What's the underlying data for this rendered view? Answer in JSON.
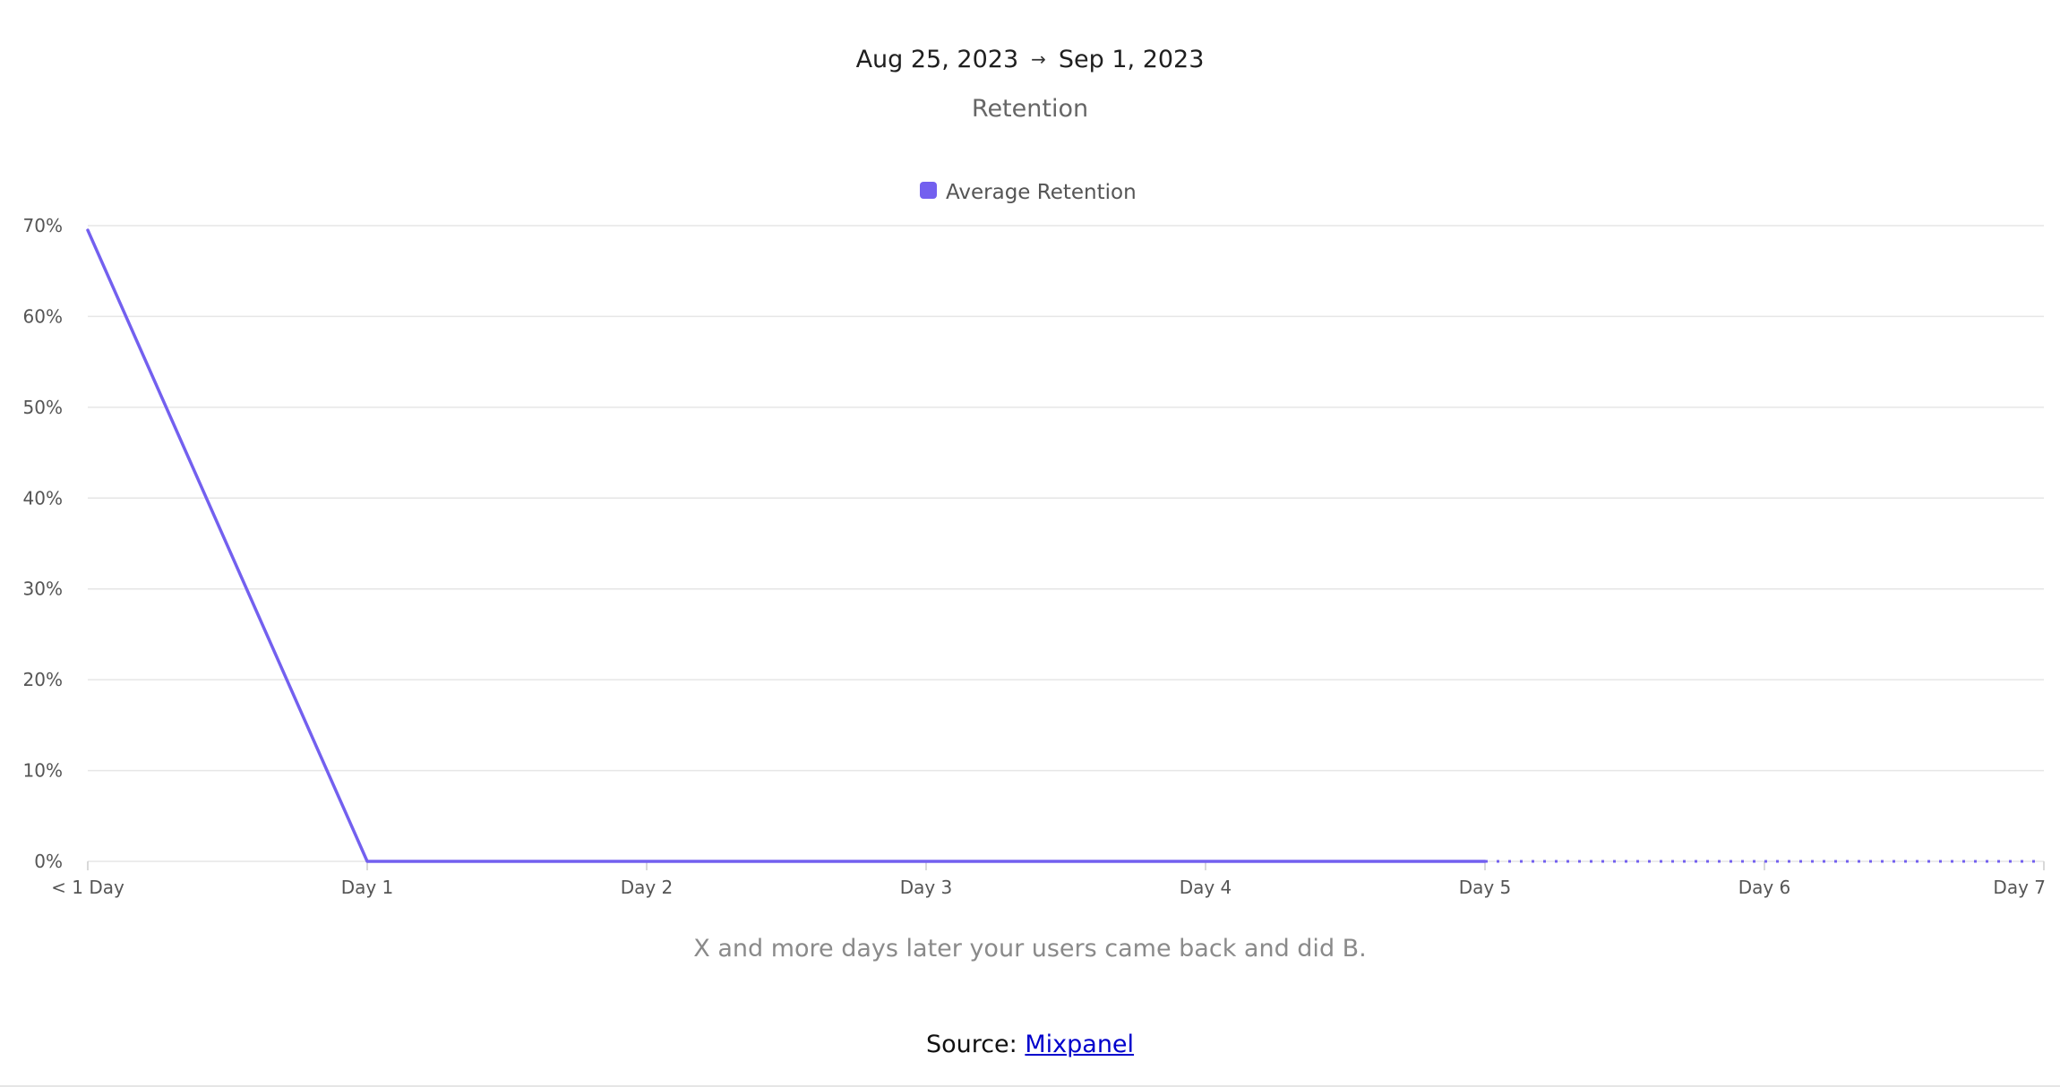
{
  "header": {
    "date_start": "Aug 25, 2023",
    "date_arrow": "→",
    "date_end": "Sep 1, 2023",
    "subtitle": "Retention"
  },
  "caption": "X and more days later your users came back and did B.",
  "source": {
    "label": "Source: ",
    "link_text": "Mixpanel"
  },
  "colors": {
    "series": "#7360ef",
    "grid": "#e6e6e6",
    "tick_text": "#555555",
    "legend_text": "#555555"
  },
  "chart_data": {
    "type": "line",
    "title": "Retention",
    "xlabel": "",
    "ylabel": "",
    "categories": [
      "< 1 Day",
      "Day 1",
      "Day 2",
      "Day 3",
      "Day 4",
      "Day 5",
      "Day 6",
      "Day 7"
    ],
    "series": [
      {
        "name": "Average Retention",
        "values": [
          69.5,
          0,
          0,
          0,
          0,
          0,
          0,
          0
        ],
        "complete_through_index": 5,
        "incomplete_style": "dotted"
      }
    ],
    "y_ticks": [
      "0%",
      "10%",
      "20%",
      "30%",
      "40%",
      "50%",
      "60%",
      "70%"
    ],
    "ylim": [
      0,
      70
    ],
    "grid": true,
    "legend_position": "top-center"
  }
}
